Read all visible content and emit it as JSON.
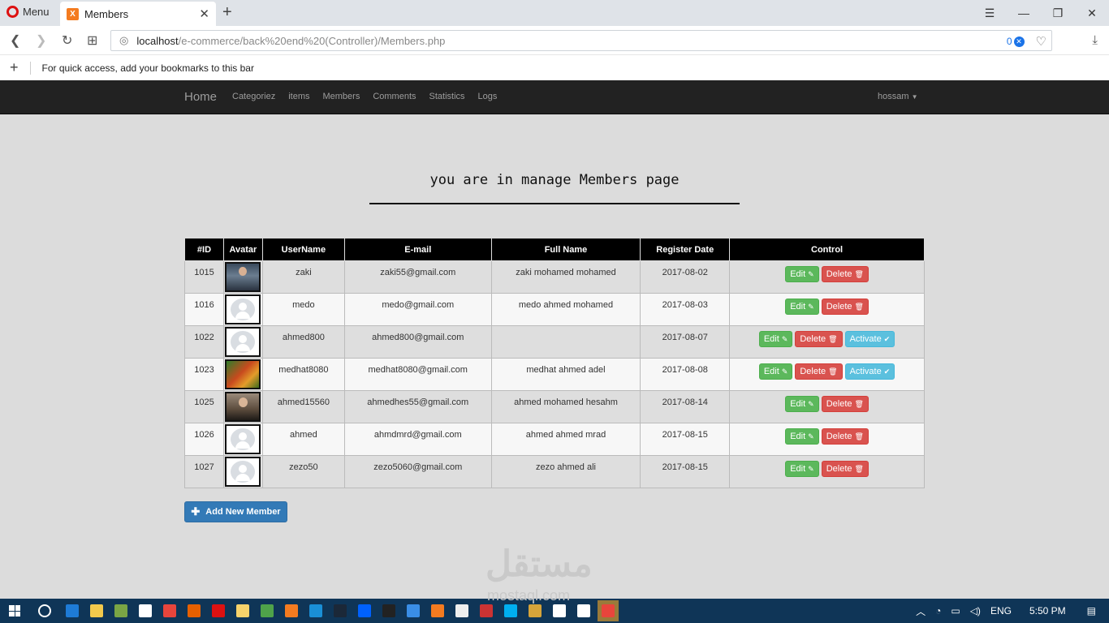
{
  "browser": {
    "menu_label": "Menu",
    "tab_title": "Members",
    "tab_favicon_letter": "X",
    "url_host": "localhost",
    "url_path": "/e-commerce/back%20end%20(Controller)/Members.php",
    "vpn_count": "0",
    "bookmark_hint": "For quick access, add your bookmarks to this bar"
  },
  "navbar": {
    "brand": "Home",
    "links": [
      "Categoriez",
      "items",
      "Members",
      "Comments",
      "Statistics",
      "Logs"
    ],
    "user": "hossam"
  },
  "page": {
    "title": "you are in manage Members page"
  },
  "table": {
    "headers": [
      "#ID",
      "Avatar",
      "UserName",
      "E-mail",
      "Full Name",
      "Register Date",
      "Control"
    ],
    "rows": [
      {
        "id": "1015",
        "avatar": "photo1",
        "username": "zaki",
        "email": "zaki55@gmail.com",
        "fullname": "zaki mohamed mohamed",
        "date": "2017-08-02",
        "activate": false
      },
      {
        "id": "1016",
        "avatar": "default",
        "username": "medo",
        "email": "medo@gmail.com",
        "fullname": "medo ahmed mohamed",
        "date": "2017-08-03",
        "activate": false
      },
      {
        "id": "1022",
        "avatar": "default",
        "username": "ahmed800",
        "email": "ahmed800@gmail.com",
        "fullname": "",
        "date": "2017-08-07",
        "activate": true
      },
      {
        "id": "1023",
        "avatar": "photo2",
        "username": "medhat8080",
        "email": "medhat8080@gmail.com",
        "fullname": "medhat ahmed adel",
        "date": "2017-08-08",
        "activate": true
      },
      {
        "id": "1025",
        "avatar": "photo3",
        "username": "ahmed15560",
        "email": "ahmedhes55@gmail.com",
        "fullname": "ahmed mohamed hesahm",
        "date": "2017-08-14",
        "activate": false
      },
      {
        "id": "1026",
        "avatar": "default",
        "username": "ahmed",
        "email": "ahmdmrd@gmail.com",
        "fullname": "ahmed ahmed mrad",
        "date": "2017-08-15",
        "activate": false
      },
      {
        "id": "1027",
        "avatar": "default",
        "username": "zezo50",
        "email": "zezo5060@gmail.com",
        "fullname": "zezo ahmed ali",
        "date": "2017-08-15",
        "activate": false
      }
    ],
    "edit_label": "Edit",
    "delete_label": "Delete",
    "activate_label": "Activate"
  },
  "add_button": "Add New Member",
  "watermark": {
    "arabic": "مستقل",
    "latin": "mostaql.com"
  },
  "taskbar": {
    "lang": "ENG",
    "time": "5:50 PM",
    "apps": [
      "edge",
      "explorer",
      "store-a",
      "store-b",
      "chrome",
      "firefox",
      "opera",
      "notes",
      "dreamweaver",
      "xampp-a",
      "teamviewer",
      "steam",
      "dropbox",
      "media",
      "network",
      "xampp-b",
      "tray-a",
      "tray-b",
      "skype",
      "photo",
      "groove",
      "mail",
      "chrome-b"
    ]
  },
  "colors": {
    "accent": "#337ab7",
    "edit": "#5cb85c",
    "delete": "#d9534f",
    "activate": "#5bc0de",
    "navbar": "#222222"
  }
}
